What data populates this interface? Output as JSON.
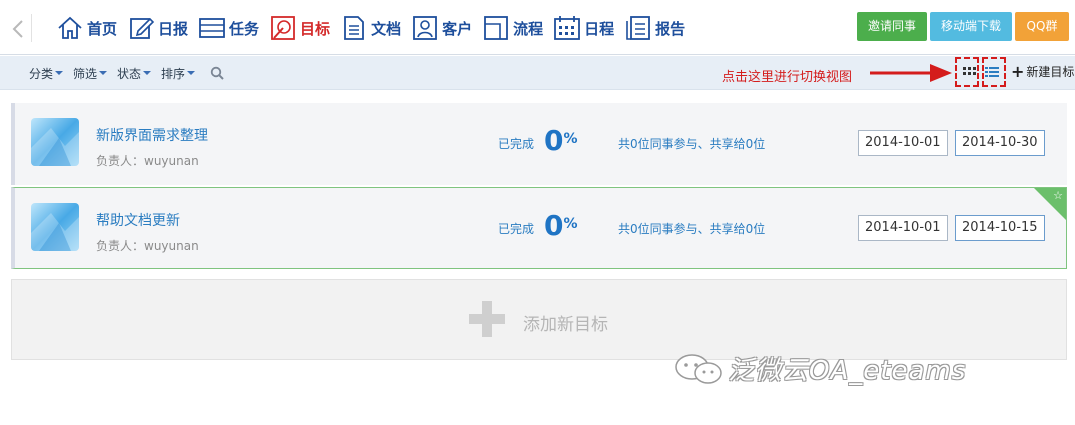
{
  "nav": {
    "items": [
      {
        "label": "首页",
        "icon": "home-icon"
      },
      {
        "label": "日报",
        "icon": "edit-icon"
      },
      {
        "label": "任务",
        "icon": "task-list-icon"
      },
      {
        "label": "目标",
        "icon": "target-icon",
        "active": true
      },
      {
        "label": "文档",
        "icon": "document-icon"
      },
      {
        "label": "客户",
        "icon": "customer-icon"
      },
      {
        "label": "流程",
        "icon": "workflow-icon"
      },
      {
        "label": "日程",
        "icon": "calendar-icon"
      },
      {
        "label": "报告",
        "icon": "report-icon"
      }
    ],
    "buttons": {
      "invite": "邀请同事",
      "mobile": "移动端下载",
      "qq": "QQ群"
    }
  },
  "toolbar": {
    "category": "分类",
    "filter": "筛选",
    "status": "状态",
    "sort": "排序",
    "hint": "点击这里进行切换视图",
    "new_goal": "新建目标"
  },
  "goals": [
    {
      "title": "新版界面需求整理",
      "owner": "负责人：wuyunan",
      "done_label": "已完成",
      "percent": "0",
      "percent_sign": "%",
      "share": "共0位同事参与、共享给0位",
      "start_date": "2014-10-01",
      "end_date": "2014-10-30"
    },
    {
      "title": "帮助文档更新",
      "owner": "负责人：wuyunan",
      "done_label": "已完成",
      "percent": "0",
      "percent_sign": "%",
      "share": "共0位同事参与、共享给0位",
      "start_date": "2014-10-01",
      "end_date": "2014-10-15",
      "starred": true
    }
  ],
  "add_new": {
    "label": "添加新目标"
  },
  "watermark": {
    "text": "泛微云OA_eteams"
  },
  "colors": {
    "nav_text": "#1e4f9c",
    "active": "#d42a2a",
    "link": "#2b7dc1",
    "hint": "#d41c1c"
  }
}
